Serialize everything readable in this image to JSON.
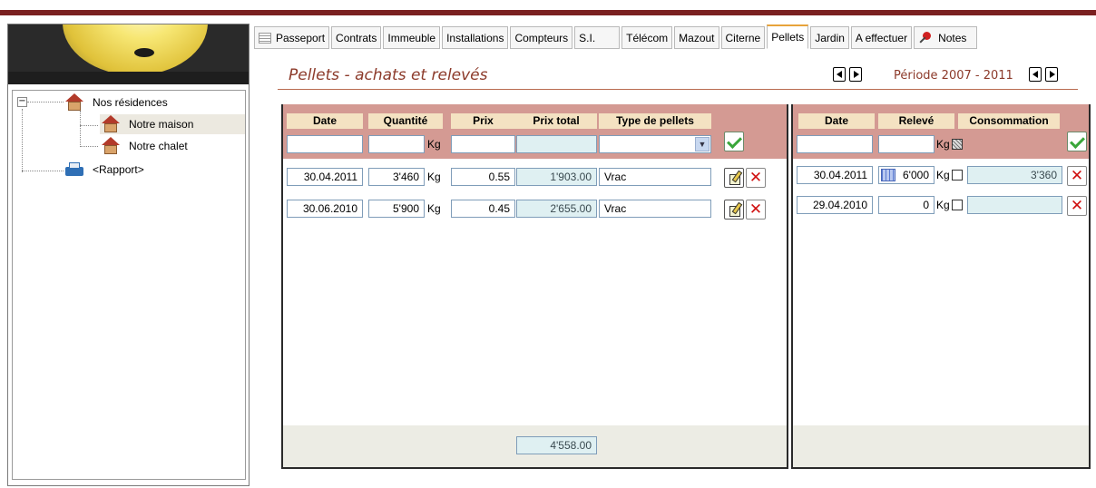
{
  "tree": {
    "root": "Nos résidences",
    "children": [
      "Notre maison",
      "Notre chalet"
    ],
    "report": "<Rapport>"
  },
  "tabs": [
    "Passeport",
    "Contrats",
    "Immeuble",
    "Installations",
    "Compteurs",
    "S.I.",
    "Télécom",
    "Mazout",
    "Citerne",
    "Pellets",
    "Jardin",
    "A effectuer",
    "Notes"
  ],
  "active_tab": "Pellets",
  "header": {
    "title": "Pellets - achats et relevés",
    "period": "Période 2007 - 2011"
  },
  "purchases": {
    "columns": [
      "Date",
      "Quantité",
      "Prix",
      "Prix total",
      "Type de pellets"
    ],
    "unit": "Kg",
    "rows": [
      {
        "date": "30.04.2011",
        "qty": "3'460",
        "price": "0.55",
        "total": "1'903.00",
        "type": "Vrac"
      },
      {
        "date": "30.06.2010",
        "qty": "5'900",
        "price": "0.45",
        "total": "2'655.00",
        "type": "Vrac"
      }
    ],
    "sum": "4'558.00"
  },
  "readings": {
    "columns": [
      "Date",
      "Relevé",
      "Consommation"
    ],
    "unit": "Kg",
    "rows": [
      {
        "date": "30.04.2011",
        "reading": "6'000",
        "consumption": "3'360"
      },
      {
        "date": "29.04.2010",
        "reading": "0",
        "consumption": ""
      }
    ]
  },
  "colors": {
    "accent": "#8c3a2a",
    "header_band": "#d49a93",
    "column_header": "#f4e2c2",
    "calc_field": "#dff0f2",
    "topbar": "#7a2020"
  }
}
